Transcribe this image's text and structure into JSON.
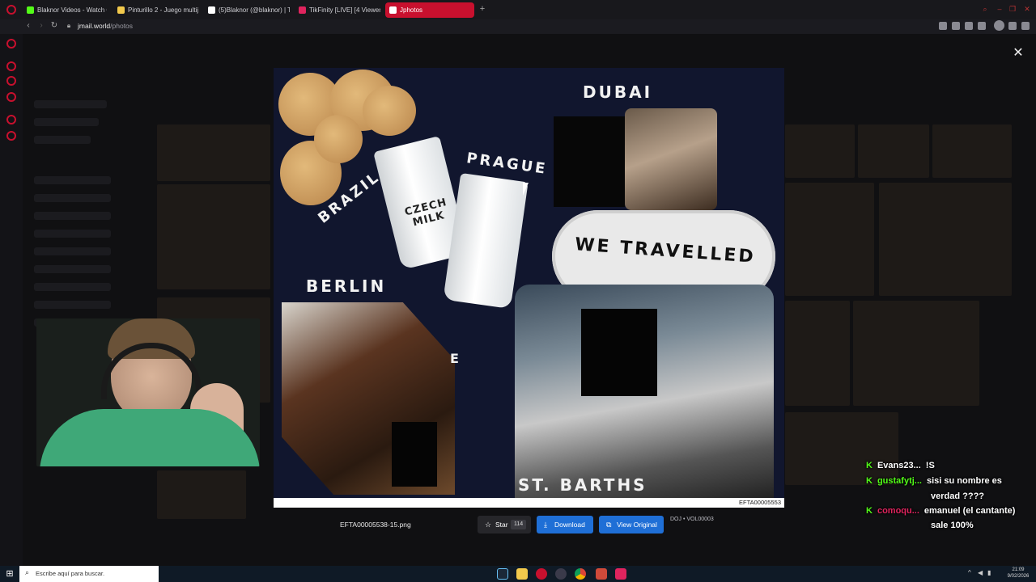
{
  "browser": {
    "tabs": [
      {
        "label": "Blaknor Videos - Watch O",
        "fav_color": "#53fc18"
      },
      {
        "label": "Pinturillo 2 - Juego multij",
        "fav_color": "#f2c94c"
      },
      {
        "label": "(5)Blaknor (@blaknor) | Ti",
        "fav_color": "#ffffff"
      },
      {
        "label": "TikFinity [LIVE] [4 Viewer",
        "fav_color": "#e0245e"
      },
      {
        "label": "Jphotos",
        "fav_color": "#ffffff"
      }
    ],
    "url_host": "jmail.world",
    "url_path": "/photos"
  },
  "lightbox": {
    "close_glyph": "✕",
    "image_caption": "EFTA00005553",
    "filename": "EFTA00005538-15.png",
    "star_label": "Star",
    "star_count": "114",
    "download_label": "Download",
    "view_original_label": "View Original",
    "volume_label": "DOJ • VOL00003",
    "collage": {
      "dubai": "DUBAI",
      "prague": "PRAGUE",
      "brazil": "BRAZIL",
      "czech_milk": "CZECH MILK",
      "we_travelled": "WE TRAVELLED",
      "berlin": "BERLIN",
      "st_barths": "ST. BARTHS",
      "e_letter": "E"
    }
  },
  "chat": [
    {
      "user": "Evans23...",
      "message": "!S",
      "user_color": "#ffffff"
    },
    {
      "user": "gustafytj...",
      "message": "sisi su nombre es",
      "user_color": "#53fc18"
    },
    {
      "user": "",
      "message": "verdad ????",
      "user_color": "#ffffff"
    },
    {
      "user": "comoqu...",
      "message": "emanuel (el cantante)",
      "user_color": "#e0245e"
    },
    {
      "user": "",
      "message": "sale 100%",
      "user_color": "#ffffff"
    }
  ],
  "taskbar": {
    "search_placeholder": "Escribe aquí para buscar.",
    "time": "21:09",
    "date": "9/02/2026"
  },
  "colors": {
    "accent": "#c8102e",
    "button_blue": "#1f6fd6",
    "kick_green": "#53fc18"
  }
}
